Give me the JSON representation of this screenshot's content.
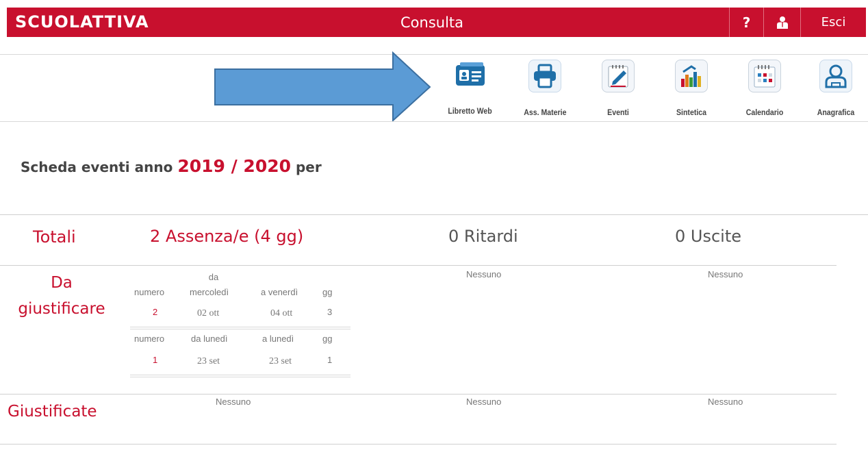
{
  "header": {
    "logo": "SCUOLATTIVA",
    "title": "Consulta",
    "help_label": "?",
    "exit_label": "Esci"
  },
  "toolbar": [
    {
      "label": "Libretto Web",
      "icon": "id-card-icon",
      "color": "#1f6fa8"
    },
    {
      "label": "Ass. Materie",
      "icon": "printer-icon",
      "color": "#1f6fa8"
    },
    {
      "label": "Eventi",
      "icon": "pencil-notepad-icon",
      "color": "#1f6fa8"
    },
    {
      "label": "Sintetica",
      "icon": "bar-chart-icon",
      "color": "#e07a1a"
    },
    {
      "label": "Calendario",
      "icon": "calendar-icon",
      "color": "#2a7fc0"
    },
    {
      "label": "Anagrafica",
      "icon": "user-icon",
      "color": "#1f6fa8"
    }
  ],
  "heading": {
    "prefix": "Scheda eventi anno",
    "year": "2019 / 2020",
    "suffix": "per"
  },
  "totals": {
    "label": "Totali",
    "absences": "2  Assenza/e (4 gg)",
    "delays": "0  Ritardi",
    "exits": "0  Uscite"
  },
  "to_justify": {
    "label_line1": "Da",
    "label_line2": "giustificare",
    "absences": [
      {
        "h_numero": "numero",
        "h_da1": "da",
        "h_da2": "mercoledì",
        "h_a": "a venerdì",
        "h_gg": "gg",
        "numero": "2",
        "da": "02 ott",
        "a": "04 ott",
        "gg": "3"
      },
      {
        "h_numero": "numero",
        "h_da1": "",
        "h_da2": "da lunedì",
        "h_a": "a lunedì",
        "h_gg": "gg",
        "numero": "1",
        "da": "23 set",
        "a": "23 set",
        "gg": "1"
      }
    ],
    "delays": "Nessuno",
    "exits": "Nessuno"
  },
  "justified": {
    "label": "Giustificate",
    "absences": "Nessuno",
    "delays": "Nessuno",
    "exits": "Nessuno"
  },
  "colors": {
    "accent": "#c8102e"
  }
}
